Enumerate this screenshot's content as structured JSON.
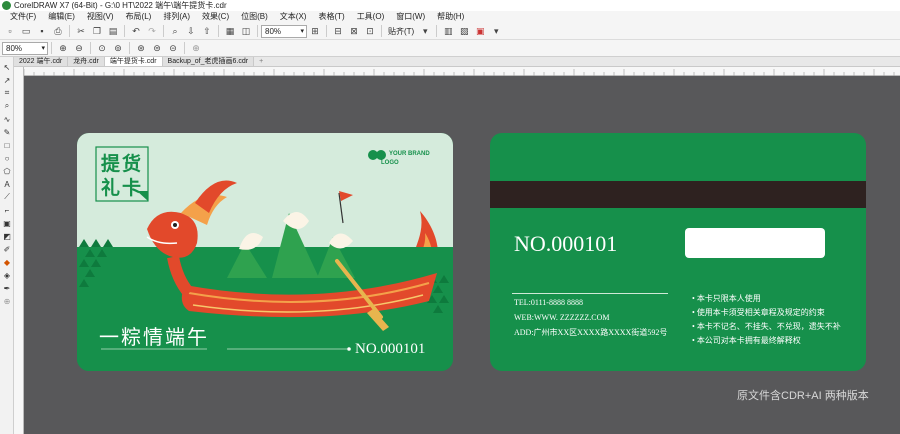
{
  "window": {
    "title": "CorelDRAW X7 (64-Bit) - G:\\0 HT\\2022 端午\\端午提货卡.cdr"
  },
  "menu": [
    "文件(F)",
    "编辑(E)",
    "视图(V)",
    "布局(L)",
    "排列(A)",
    "效果(C)",
    "位图(B)",
    "文本(X)",
    "表格(T)",
    "工具(O)",
    "窗口(W)",
    "帮助(H)"
  ],
  "toolbar": {
    "zoom_value": "80%",
    "paste_label": "贴齐(T)"
  },
  "propbar": {
    "zoom_value": "80%"
  },
  "tabs": [
    "2022 端午.cdr",
    "龙舟.cdr",
    "端午提货卡.cdr",
    "Backup_of_老虎插画6.cdr",
    "+"
  ],
  "active_tab": 2,
  "front_card": {
    "title_chars": [
      "提",
      "货",
      "礼",
      "卡"
    ],
    "brand_line1": "YOUR BRAND",
    "brand_line2": "LOGO",
    "slogan": "一粽情端午",
    "number": "NO.000101"
  },
  "back_card": {
    "number": "NO.000101",
    "tel": "TEL:0111-8888 8888",
    "web": "WEB:WWW. ZZZZZZ.COM",
    "address": "ADD:广州市XX区XXXX路XXXX街道592号",
    "rules": [
      "本卡只限本人使用",
      "使用本卡须受相关章程及规定的约束",
      "本卡不记名、不挂失、不兑现，遗失不补",
      "本公司对本卡拥有最终解释权"
    ]
  },
  "watermark": "原文件含CDR+AI 两种版本",
  "colors": {
    "card_green": "#16904b",
    "light_green": "#d5ebdc",
    "canvas_gray": "#58585a",
    "magnetic_stripe": "#2e2220",
    "dragon_red": "#e2492b"
  },
  "icons": {
    "toolbox": [
      "pick-tool-icon",
      "shape-tool-icon",
      "crop-tool-icon",
      "zoom-tool-icon",
      "freehand-tool-icon",
      "artistic-media-icon",
      "rectangle-tool-icon",
      "ellipse-tool-icon",
      "polygon-tool-icon",
      "text-tool-icon",
      "parallel-dimension-icon",
      "connector-tool-icon",
      "drop-shadow-icon",
      "transparency-icon",
      "color-eyedropper-icon",
      "interactive-fill-icon",
      "smart-fill-icon",
      "outline-pen-icon",
      "add-icon"
    ]
  }
}
